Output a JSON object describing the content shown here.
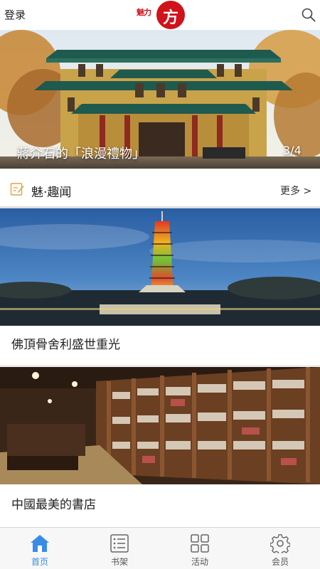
{
  "header": {
    "login_label": "登录",
    "logo_text": "魅力",
    "logo_glyph": "方",
    "search_icon": "search-icon"
  },
  "banner": {
    "caption": "蔣介石的「浪漫禮物」",
    "page_indicator": "3/4"
  },
  "section": {
    "title": "魅·趣闻",
    "more_label": "更多 >",
    "icon": "note-edit-icon"
  },
  "articles": [
    {
      "title": "佛頂骨舍利盛世重光"
    },
    {
      "title": "中國最美的書店"
    }
  ],
  "tabbar": {
    "active_color": "#3a8be8",
    "tabs": [
      {
        "label": "首页",
        "icon": "home-icon",
        "active": true
      },
      {
        "label": "书架",
        "icon": "list-icon",
        "active": false
      },
      {
        "label": "活动",
        "icon": "grid-icon",
        "active": false
      },
      {
        "label": "会员",
        "icon": "gear-icon",
        "active": false
      }
    ]
  }
}
